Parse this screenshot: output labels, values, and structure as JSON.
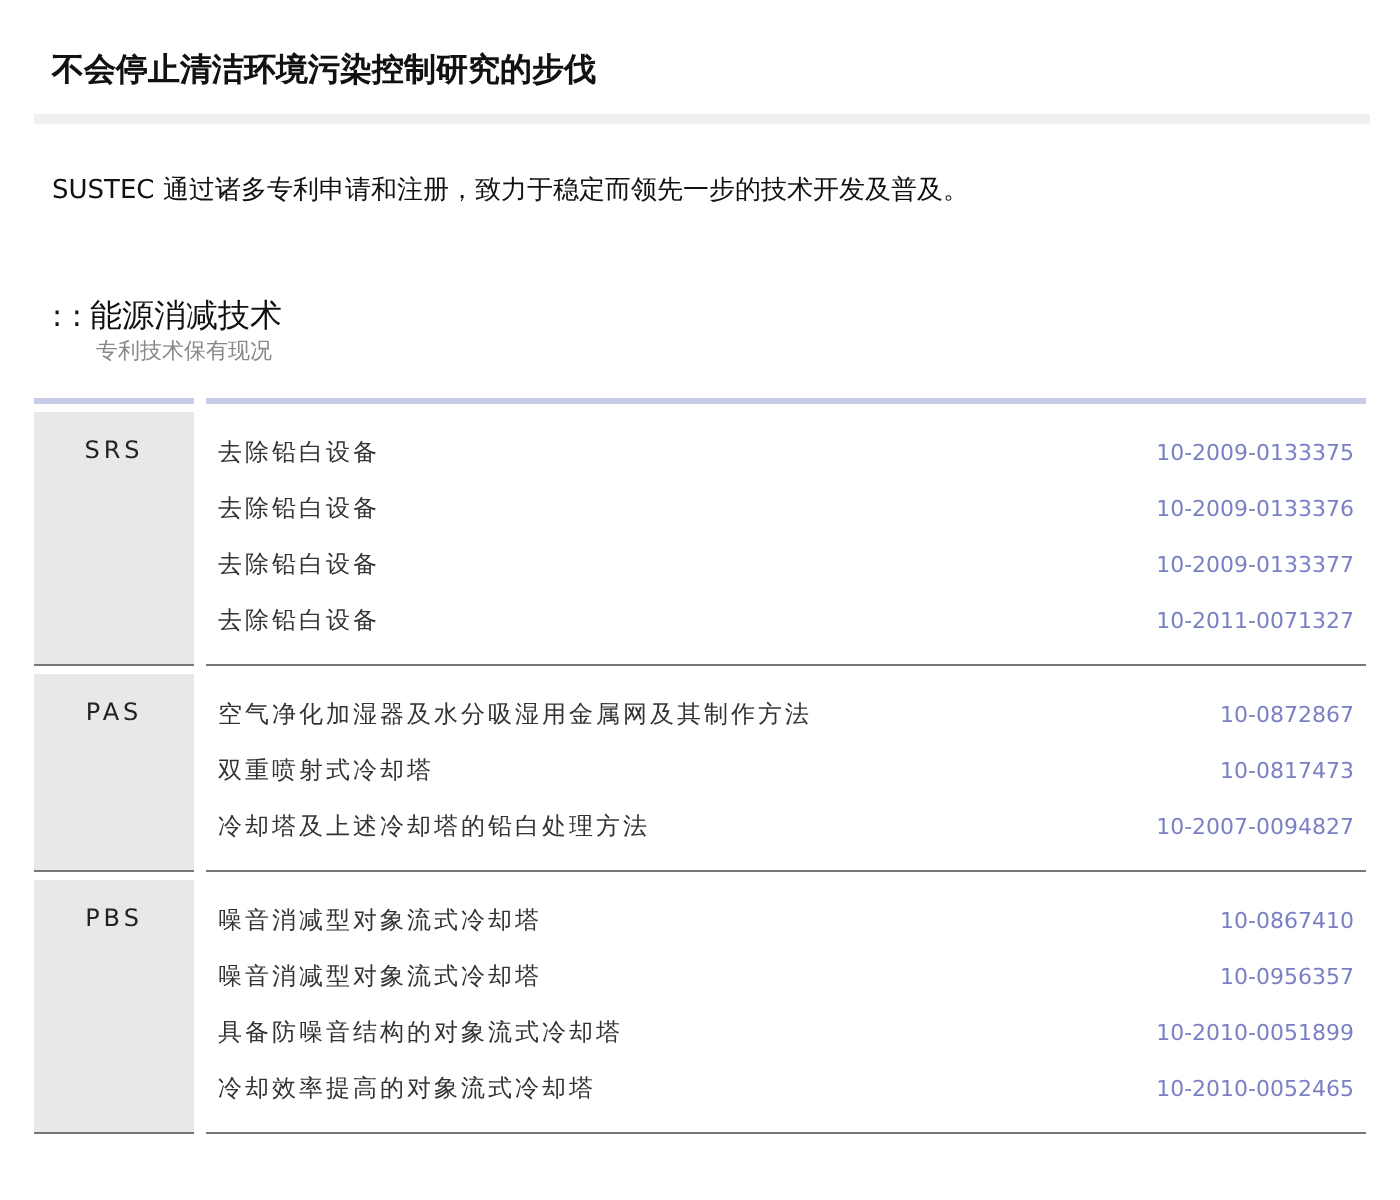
{
  "title": "不会停止清洁环境污染控制研究的步伐",
  "intro": "SUSTEC 通过诸多专利申请和注册，致力于稳定而领先一步的技术开发及普及。",
  "section": {
    "marker": ": :",
    "heading": "能源消减技术",
    "subheading": "专利技术保有现况"
  },
  "groups": [
    {
      "code": "SRS",
      "patents": [
        {
          "name": "去除铅白设备",
          "number": "10-2009-0133375"
        },
        {
          "name": "去除铅白设备",
          "number": "10-2009-0133376"
        },
        {
          "name": "去除铅白设备",
          "number": "10-2009-0133377"
        },
        {
          "name": "去除铅白设备",
          "number": "10-2011-0071327"
        }
      ]
    },
    {
      "code": "PAS",
      "patents": [
        {
          "name": "空气净化加湿器及水分吸湿用金属网及其制作方法",
          "number": "10-0872867"
        },
        {
          "name": "双重喷射式冷却塔",
          "number": "10-0817473"
        },
        {
          "name": "冷却塔及上述冷却塔的铅白处理方法",
          "number": "10-2007-0094827"
        }
      ]
    },
    {
      "code": "PBS",
      "patents": [
        {
          "name": "噪音消减型对象流式冷却塔",
          "number": "10-0867410"
        },
        {
          "name": "噪音消减型对象流式冷却塔",
          "number": "10-0956357"
        },
        {
          "name": "具备防噪音结构的对象流式冷却塔",
          "number": "10-2010-0051899"
        },
        {
          "name": "冷却效率提高的对象流式冷却塔",
          "number": "10-2010-0052465"
        }
      ]
    }
  ]
}
